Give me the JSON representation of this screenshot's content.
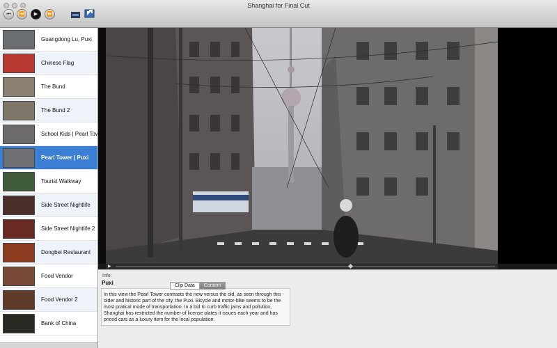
{
  "window": {
    "title": "Shanghai for Final Cut"
  },
  "toolbar": {
    "rewind_icon": "skip-back-icon",
    "back_icon": "rewind-icon",
    "play_icon": "play-icon",
    "forward_icon": "fast-forward-icon",
    "clapper_icon": "clapperboard-icon",
    "export_icon": "export-icon"
  },
  "clips": [
    {
      "label": "Guangdong Lu, Puxi",
      "thumb": "#6b6e70"
    },
    {
      "label": "Chinese Flag",
      "thumb": "#b83a32"
    },
    {
      "label": "The Bund",
      "thumb": "#8a8172"
    },
    {
      "label": "The Bund 2",
      "thumb": "#7e7668"
    },
    {
      "label": "School Kids | Pearl Tower",
      "thumb": "#6c6b69"
    },
    {
      "label": "Pearl Tower | Puxi",
      "thumb": "#6f7175"
    },
    {
      "label": "Tourist Walkway",
      "thumb": "#3f5b3a"
    },
    {
      "label": "Side Street Nightlife",
      "thumb": "#4a2f2b"
    },
    {
      "label": "Side Street Nightlife 2",
      "thumb": "#6a2a24"
    },
    {
      "label": "Dongbei Restaurant",
      "thumb": "#8c3b1f"
    },
    {
      "label": "Food Vendor",
      "thumb": "#7a4a38"
    },
    {
      "label": "Food Vendor 2",
      "thumb": "#5f3a29"
    },
    {
      "label": "Bank of China",
      "thumb": "#2a2a24"
    }
  ],
  "selected_clip": "Pearl Tower | Puxi",
  "info": {
    "label": "Info:",
    "title": "Puxi",
    "tab_clip_data": "Clip Data",
    "tab_content": "Content",
    "description": "In this view the Pearl Tower contrasts the new versus the old, as seen through this older and historic part of the city, the Puxi. Bicycle and motor-bike seems to be the most pratical mode of transportation. In a bid to curb traffic jams and pollution, Shanghai has restricted the number of license plates it issues each year and has priced cars as a luxury item for the local population."
  },
  "colors": {
    "selection": "#3b7fd4",
    "alt_row": "#eef3fa"
  }
}
